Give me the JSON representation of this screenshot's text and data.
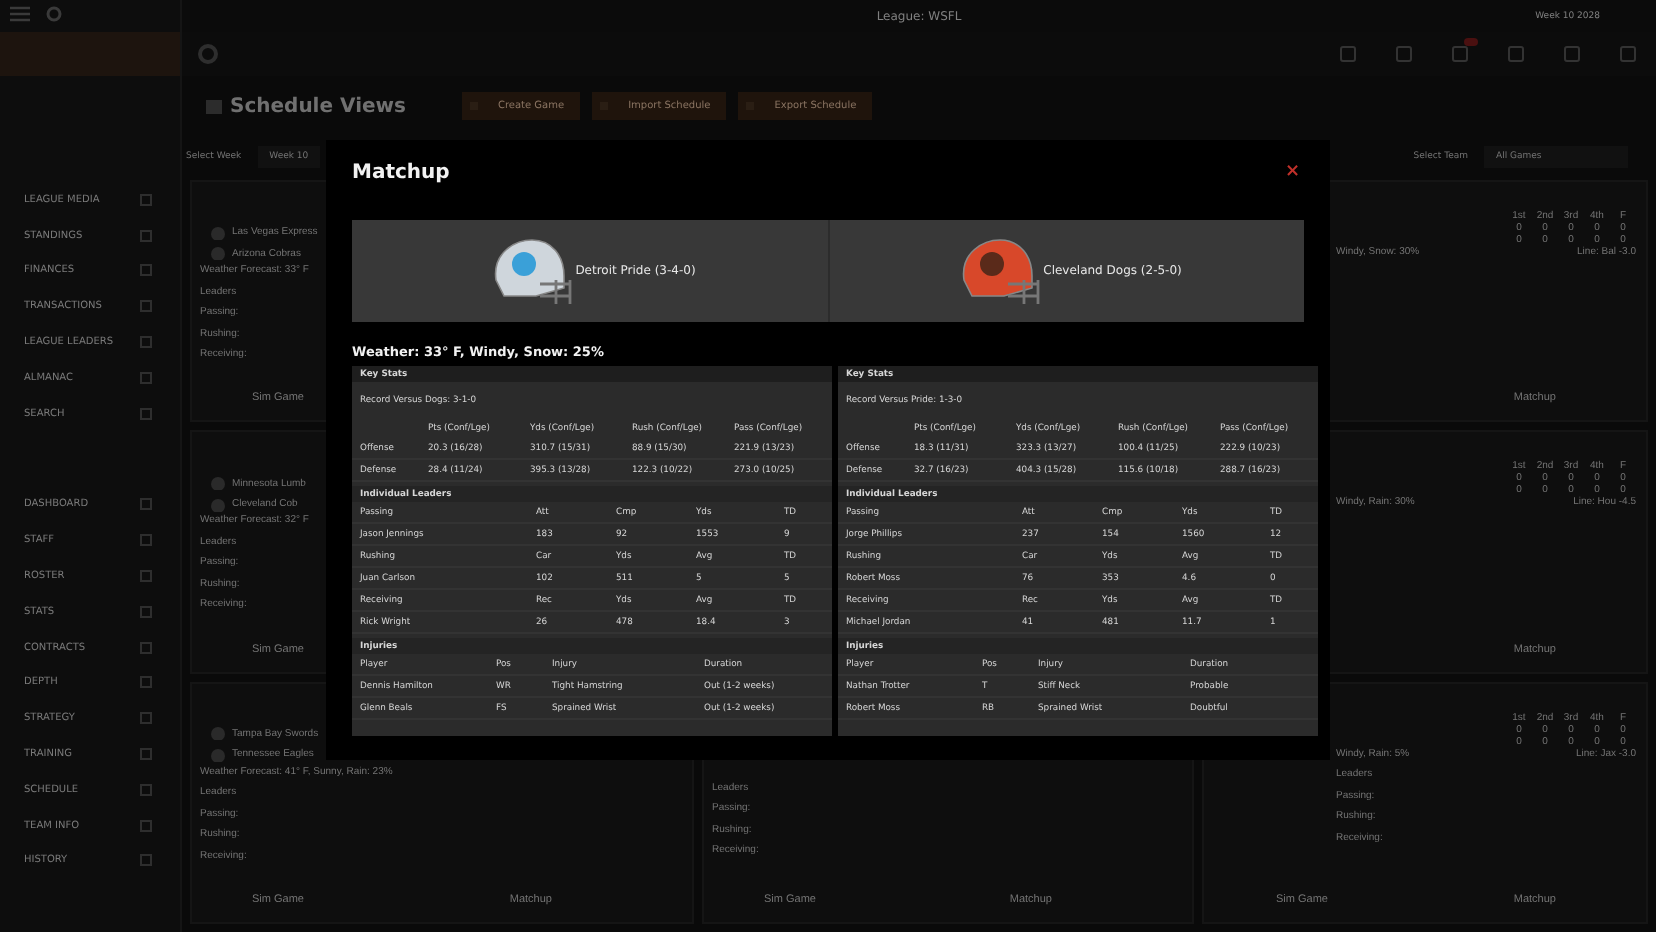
{
  "top_bar": {
    "league": "League: WSFL",
    "week": "Week 10 2028"
  },
  "sidebar": {
    "league_items": [
      "LEAGUE MEDIA",
      "STANDINGS",
      "FINANCES",
      "TRANSACTIONS",
      "LEAGUE LEADERS",
      "ALMANAC",
      "SEARCH"
    ],
    "team_items": [
      "DASHBOARD",
      "STAFF",
      "ROSTER",
      "STATS",
      "CONTRACTS",
      "DEPTH",
      "STRATEGY",
      "TRAINING",
      "SCHEDULE",
      "TEAM INFO",
      "HISTORY"
    ]
  },
  "header": {
    "title": "Schedule Views",
    "buttons": [
      "Create Game",
      "Import Schedule",
      "Export Schedule"
    ]
  },
  "filters": {
    "week_label": "Select Week",
    "week_value": "Week 10",
    "team_label": "Select Team",
    "team_value": "All Games"
  },
  "games": {
    "left": [
      {
        "teams": [
          "Las Vegas Express",
          "Arizona Cobras"
        ],
        "weather": "Weather Forecast: 33° F",
        "leaders": [
          "Leaders",
          "Passing:",
          "Rushing:",
          "Receiving:"
        ],
        "actions": [
          "Sim Game"
        ]
      },
      {
        "teams": [
          "Minnesota Lumb",
          "Cleveland Cob"
        ],
        "weather": "Weather Forecast: 32° F",
        "leaders": [
          "Leaders",
          "Passing:",
          "Rushing:",
          "Receiving:"
        ],
        "actions": [
          "Sim Game"
        ]
      },
      {
        "teams": [
          "Tampa Bay Swords",
          "Tennessee Eagles"
        ],
        "weather": "Weather Forecast: 41° F, Sunny, Rain: 23%",
        "leaders": [
          "Leaders",
          "Passing:",
          "Rushing:",
          "Receiving:"
        ],
        "actions": [
          "Sim Game",
          "Matchup"
        ]
      }
    ],
    "middle": [
      {
        "leaders": [
          "Leaders",
          "Passing:",
          "Rushing:",
          "Receiving:"
        ],
        "actions": [
          "Sim Game",
          "Matchup"
        ]
      }
    ],
    "right": [
      {
        "quarters": [
          "1st",
          "2nd",
          "3rd",
          "4th",
          "F"
        ],
        "scores": [
          [
            "0",
            "0",
            "0",
            "0",
            "0"
          ],
          [
            "0",
            "0",
            "0",
            "0",
            "0"
          ]
        ],
        "weather": "Windy, Snow: 30%",
        "line": "Line: Bal -3.0",
        "actions": [
          "Matchup"
        ]
      },
      {
        "quarters": [
          "1st",
          "2nd",
          "3rd",
          "4th",
          "F"
        ],
        "scores": [
          [
            "0",
            "0",
            "0",
            "0",
            "0"
          ],
          [
            "0",
            "0",
            "0",
            "0",
            "0"
          ]
        ],
        "weather": "Windy, Rain: 30%",
        "line": "Line: Hou -4.5",
        "actions": [
          "Matchup"
        ]
      },
      {
        "quarters": [
          "1st",
          "2nd",
          "3rd",
          "4th",
          "F"
        ],
        "scores": [
          [
            "0",
            "0",
            "0",
            "0",
            "0"
          ],
          [
            "0",
            "0",
            "0",
            "0",
            "0"
          ]
        ],
        "weather": "Windy, Rain: 5%",
        "line": "Line: Jax -3.0",
        "leaders": [
          "Leaders",
          "Passing:",
          "Rushing:",
          "Receiving:"
        ],
        "actions": [
          "Sim Game",
          "Matchup"
        ]
      }
    ]
  },
  "modal": {
    "title": "Matchup",
    "close": "×",
    "teams": [
      {
        "name": "Detroit Pride (3-4-0)",
        "color": "#cfd6dc"
      },
      {
        "name": "Cleveland Dogs (2-5-0)",
        "color": "#d8482a"
      }
    ],
    "weather": "Weather: 33° F, Windy, Snow: 25%",
    "panels": [
      {
        "key_stats_title": "Key Stats",
        "record": "Record Versus Dogs: 3-1-0",
        "columns": [
          "Pts (Conf/Lge)",
          "Yds (Conf/Lge)",
          "Rush (Conf/Lge)",
          "Pass (Conf/Lge)"
        ],
        "rows": [
          {
            "label": "Offense",
            "values": [
              "20.3 (16/28)",
              "310.7 (15/31)",
              "88.9 (15/30)",
              "221.9 (13/23)"
            ]
          },
          {
            "label": "Defense",
            "values": [
              "28.4 (11/24)",
              "395.3 (13/28)",
              "122.3 (10/22)",
              "273.0 (10/25)"
            ]
          }
        ],
        "leaders_title": "Individual Leaders",
        "leaders": [
          {
            "header": [
              "Passing",
              "Att",
              "Cmp",
              "Yds",
              "TD"
            ],
            "row": [
              "Jason Jennings",
              "183",
              "92",
              "1553",
              "9"
            ]
          },
          {
            "header": [
              "Rushing",
              "Car",
              "Yds",
              "Avg",
              "TD"
            ],
            "row": [
              "Juan Carlson",
              "102",
              "511",
              "5",
              "5"
            ]
          },
          {
            "header": [
              "Receiving",
              "Rec",
              "Yds",
              "Avg",
              "TD"
            ],
            "row": [
              "Rick Wright",
              "26",
              "478",
              "18.4",
              "3"
            ]
          }
        ],
        "injuries_title": "Injuries",
        "injury_columns": [
          "Player",
          "Pos",
          "Injury",
          "Duration"
        ],
        "injuries": [
          [
            "Dennis Hamilton",
            "WR",
            "Tight Hamstring",
            "Out (1-2 weeks)"
          ],
          [
            "Glenn Beals",
            "FS",
            "Sprained Wrist",
            "Out (1-2 weeks)"
          ]
        ]
      },
      {
        "key_stats_title": "Key Stats",
        "record": "Record Versus Pride: 1-3-0",
        "columns": [
          "Pts (Conf/Lge)",
          "Yds (Conf/Lge)",
          "Rush (Conf/Lge)",
          "Pass (Conf/Lge)"
        ],
        "rows": [
          {
            "label": "Offense",
            "values": [
              "18.3 (11/31)",
              "323.3 (13/27)",
              "100.4 (11/25)",
              "222.9 (10/23)"
            ]
          },
          {
            "label": "Defense",
            "values": [
              "32.7 (16/23)",
              "404.3 (15/28)",
              "115.6 (10/18)",
              "288.7 (16/23)"
            ]
          }
        ],
        "leaders_title": "Individual Leaders",
        "leaders": [
          {
            "header": [
              "Passing",
              "Att",
              "Cmp",
              "Yds",
              "TD"
            ],
            "row": [
              "Jorge Phillips",
              "237",
              "154",
              "1560",
              "12"
            ]
          },
          {
            "header": [
              "Rushing",
              "Car",
              "Yds",
              "Avg",
              "TD"
            ],
            "row": [
              "Robert Moss",
              "76",
              "353",
              "4.6",
              "0"
            ]
          },
          {
            "header": [
              "Receiving",
              "Rec",
              "Yds",
              "Avg",
              "TD"
            ],
            "row": [
              "Michael Jordan",
              "41",
              "481",
              "11.7",
              "1"
            ]
          }
        ],
        "injuries_title": "Injuries",
        "injury_columns": [
          "Player",
          "Pos",
          "Injury",
          "Duration"
        ],
        "injuries": [
          [
            "Nathan Trotter",
            "T",
            "Stiff Neck",
            "Probable"
          ],
          [
            "Robert Moss",
            "RB",
            "Sprained Wrist",
            "Doubtful"
          ]
        ]
      }
    ]
  }
}
